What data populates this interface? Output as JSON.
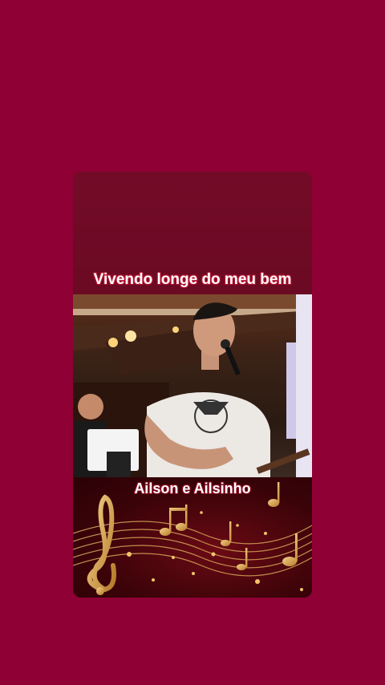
{
  "card": {
    "song_title": "Vivendo longe do meu bem",
    "artist": "Ailson e Ailsinho"
  },
  "colors": {
    "background": "#8f0034",
    "top_band": "#730b27",
    "music_gold": "#e0b15a"
  },
  "icons": [
    "treble-clef-icon",
    "music-note-icon"
  ]
}
